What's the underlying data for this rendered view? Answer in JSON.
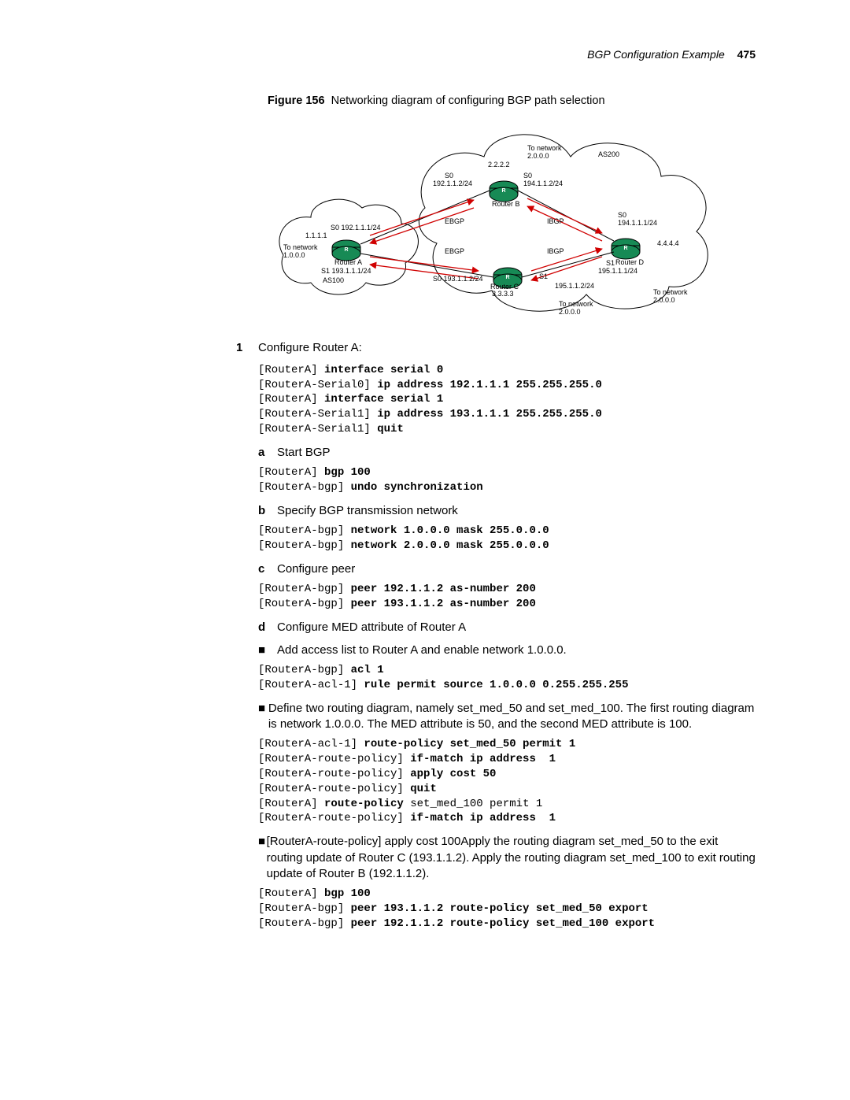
{
  "header": {
    "section": "BGP Configuration Example",
    "page": "475"
  },
  "figure": {
    "label": "Figure 156",
    "caption": "Networking diagram of configuring BGP path selection",
    "labels": {
      "as100": "AS100",
      "as200": "AS200",
      "routerA": "Router A",
      "routerB": "Router B",
      "routerC": "Router C",
      "routerD": "Router D",
      "toNet1": "To network\n1.0.0.0",
      "toNet2a": "To network\n2.0.0.0",
      "toNet2b": "To network\n2.0.0.0",
      "toNet2c": "To network\n2.0.0.0",
      "ipA": "1.1.1.1",
      "ipB": "2.2.2.2",
      "ipC": "3.3.3.3",
      "ipD": "4.4.4.4",
      "s0A": "S0 192.1.1.1/24",
      "s1A": "S1 193.1.1.1/24",
      "s0B_left": "S0\n192.1.1.2/24",
      "s0B_right": "S0\n194.1.1.2/24",
      "s0C": "S0 193.1.1.2/24",
      "s1C": "S1\n195.1.1.2/24",
      "s0D": "S0\n194.1.1.1/24",
      "s1D": "S1\n195.1.1.1/24",
      "ebgp": "EBGP",
      "ibgp": "IBGP"
    }
  },
  "steps": {
    "s1": "Configure Router A:",
    "s1_code": "[RouterA] <b>interface serial 0</b>\n[RouterA-Serial0] <b>ip address 192.1.1.1 255.255.255.0</b>\n[RouterA] <b>interface serial 1</b>\n[RouterA-Serial1] <b>ip address 193.1.1.1 255.255.255.0</b>\n[RouterA-Serial1] <b>quit</b>",
    "s1a": "Start BGP",
    "s1a_code": "[RouterA] <b>bgp 100</b>\n[RouterA-bgp] <b>undo synchronization</b>",
    "s1b": "Specify BGP transmission network",
    "s1b_code": "[RouterA-bgp] <b>network 1.0.0.0 mask 255.0.0.0</b>\n[RouterA-bgp] <b>network 2.0.0.0 mask 255.0.0.0</b>",
    "s1c": "Configure peer",
    "s1c_code": "[RouterA-bgp] <b>peer 192.1.1.2 as-number 200</b>\n[RouterA-bgp] <b>peer 193.1.1.2 as-number 200</b>",
    "s1d": "Configure MED attribute of Router A",
    "s1d_b1": "Add access list to Router A and enable network 1.0.0.0.",
    "s1d_b1_code": "[RouterA-bgp] <b>acl 1</b>\n[RouterA-acl-1] <b>rule permit source 1.0.0.0 0.255.255.255</b>",
    "s1d_b2": "Define two routing diagram, namely set_med_50 and set_med_100. The first routing diagram is network 1.0.0.0. The MED attribute is 50, and the second MED attribute is 100.",
    "s1d_b2_code": "[RouterA-acl-1] <b>route-policy set_med_50 permit 1</b>\n[RouterA-route-policy] <b>if-match ip address  1</b>\n[RouterA-route-policy] <b>apply cost 50</b>\n[RouterA-route-policy] <b>quit</b>\n[RouterA] <b>route-policy</b> set_med_100 permit 1\n[RouterA-route-policy] <b>if-match ip address  1</b>",
    "s1d_b3": "[RouterA-route-policy] apply cost 100Apply the routing diagram set_med_50 to the exit routing update of Router C (193.1.1.2). Apply the routing diagram set_med_100 to exit routing update of Router B (192.1.1.2).",
    "s1d_b3_code": "[RouterA] <b>bgp 100</b>\n[RouterA-bgp] <b>peer 193.1.1.2 route-policy set_med_50 export</b>\n[RouterA-bgp] <b>peer 192.1.1.2 route-policy set_med_100 export</b>"
  }
}
